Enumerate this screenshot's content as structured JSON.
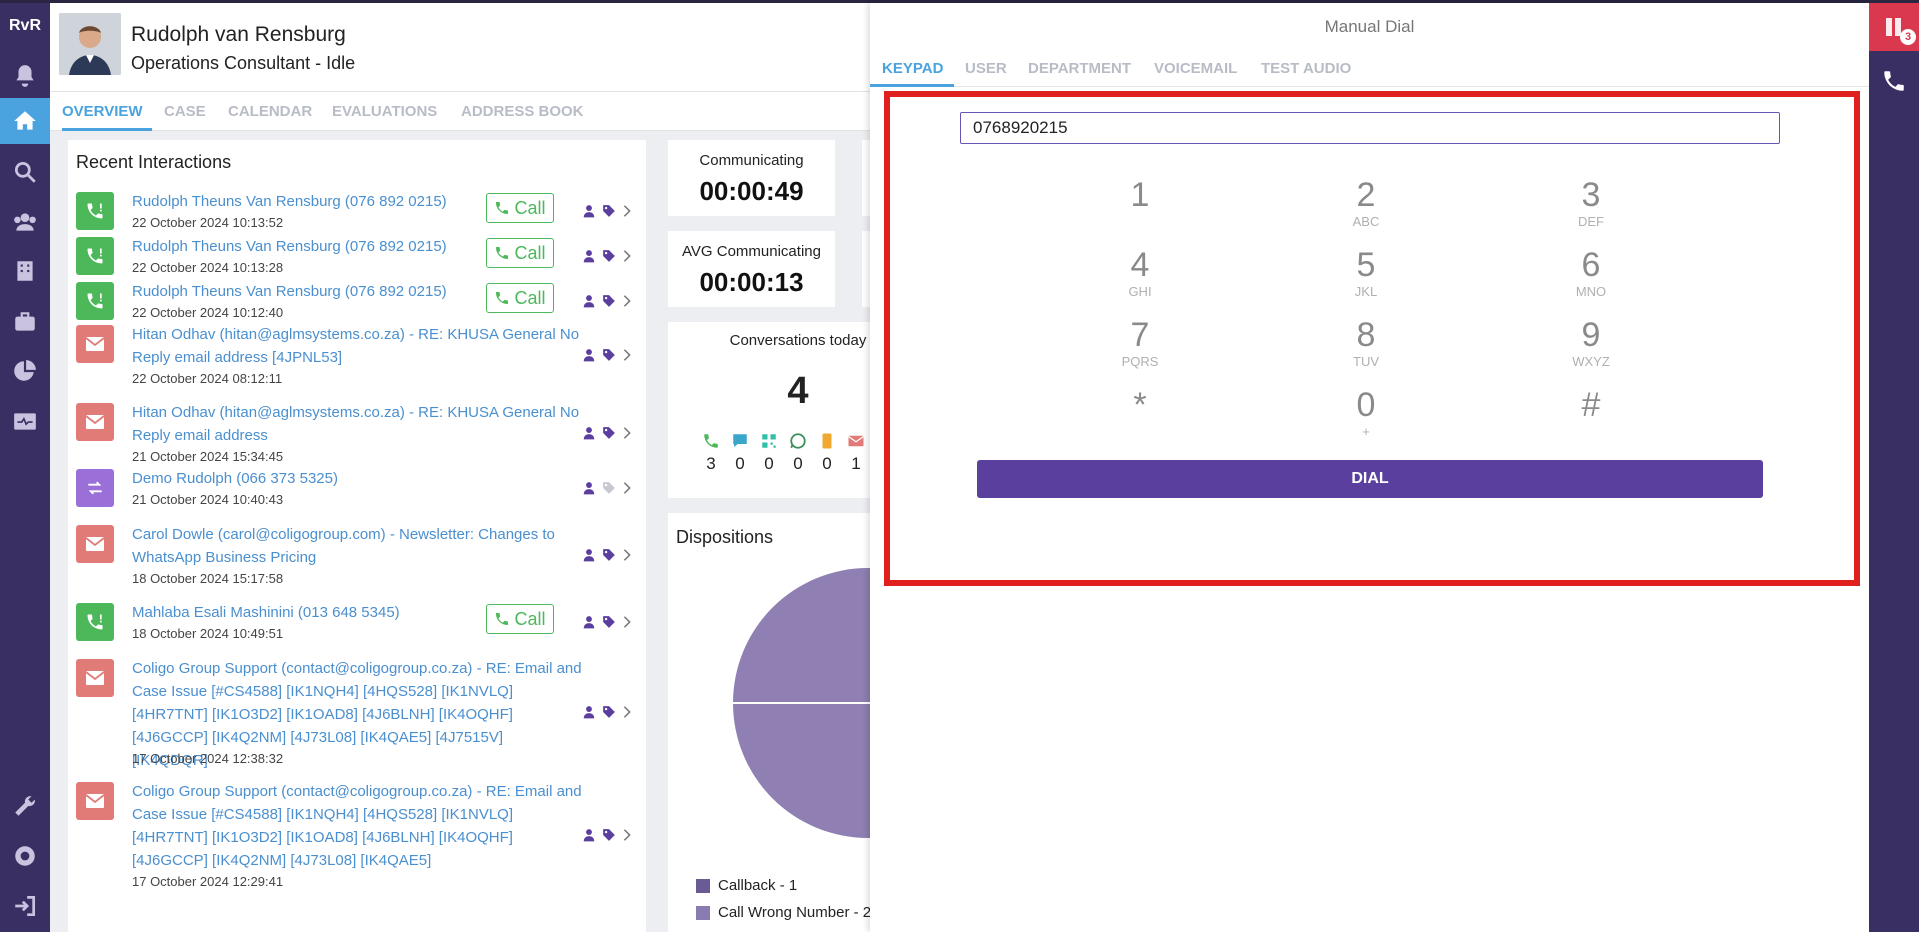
{
  "app": {
    "logo": "RvR"
  },
  "user": {
    "name": "Rudolph van Rensburg",
    "role_status": "Operations Consultant - Idle"
  },
  "tabs": [
    "OVERVIEW",
    "CASE",
    "CALENDAR",
    "EVALUATIONS",
    "ADDRESS BOOK"
  ],
  "recent": {
    "title": "Recent Interactions",
    "call_label": "Call",
    "items": [
      {
        "type": "call",
        "title": "Rudolph Theuns Van Rensburg (076 892 0215)",
        "date": "22 October 2024 10:13:52",
        "has_call": true
      },
      {
        "type": "call",
        "title": "Rudolph Theuns Van Rensburg (076 892 0215)",
        "date": "22 October 2024 10:13:28",
        "has_call": true
      },
      {
        "type": "call",
        "title": "Rudolph Theuns Van Rensburg (076 892 0215)",
        "date": "22 October 2024 10:12:40",
        "has_call": true
      },
      {
        "type": "mail",
        "title": "Hitan Odhav (hitan@aglmsystems.co.za) - RE: KHUSA General No Reply email address [4JPNL53]",
        "date": "22 October 2024 08:12:11",
        "has_call": false
      },
      {
        "type": "mail",
        "title": "Hitan Odhav (hitan@aglmsystems.co.za) - RE: KHUSA General No Reply email address",
        "date": "21 October 2024 15:34:45",
        "has_call": false
      },
      {
        "type": "xfer",
        "title": "Demo Rudolph (066 373 5325)",
        "date": "21 October 2024 10:40:43",
        "has_call": false
      },
      {
        "type": "mail",
        "title": "Carol Dowle (carol@coligogroup.com) - Newsletter: Changes to WhatsApp Business Pricing",
        "date": "18 October 2024 15:17:58",
        "has_call": false
      },
      {
        "type": "call",
        "title": "Mahlaba Esali Mashinini (013 648 5345)",
        "date": "18 October 2024 10:49:51",
        "has_call": true
      },
      {
        "type": "mail",
        "title": "Coligo Group Support (contact@coligogroup.co.za) - RE: Email and Case Issue [#CS4588] [IK1NQH4] [4HQS528] [IK1NVLQ] [4HR7TNT] [IK1O3D2] [IK1OAD8] [4J6BLNH] [IK4OQHF] [4J6GCCP] [IK4Q2NM] [4J73L08] [IK4QAE5] [4J7515V] [IK4QDQR]",
        "date": "17 October 2024 12:38:32",
        "has_call": false
      },
      {
        "type": "mail",
        "title": "Coligo Group Support (contact@coligogroup.co.za) - RE: Email and Case Issue [#CS4588] [IK1NQH4] [4HQS528] [IK1NVLQ] [4HR7TNT] [IK1O3D2] [IK1OAD8] [4J6BLNH] [IK4OQHF] [4J6GCCP] [IK4Q2NM] [4J73L08] [IK4QAE5]",
        "date": "17 October 2024 12:29:41",
        "has_call": false
      }
    ]
  },
  "stats": {
    "communicating_label": "Communicating",
    "communicating_value": "00:00:49",
    "avg_label": "AVG Communicating",
    "avg_value": "00:00:13"
  },
  "conversations": {
    "title": "Conversations today",
    "count": "4",
    "channels": [
      {
        "icon": "phone-icon",
        "color": "#4cb85a",
        "count": "3"
      },
      {
        "icon": "chat-icon",
        "color": "#3aa6c9",
        "count": "0"
      },
      {
        "icon": "qr-icon",
        "color": "#2fbfa4",
        "count": "0"
      },
      {
        "icon": "whatsapp-icon",
        "color": "#3a8f5a",
        "count": "0"
      },
      {
        "icon": "sms-icon",
        "color": "#f0a830",
        "count": "0"
      },
      {
        "icon": "email-icon",
        "color": "#e07b77",
        "count": "1"
      }
    ]
  },
  "dispositions": {
    "title": "Dispositions",
    "legend": [
      {
        "label": "Callback - 1",
        "color": "#6b5b95"
      },
      {
        "label": "Call Wrong Number - 2",
        "color": "#8a7bb0"
      }
    ]
  },
  "dial": {
    "title": "Manual Dial",
    "tabs": [
      "KEYPAD",
      "USER",
      "DEPARTMENT",
      "VOICEMAIL",
      "TEST AUDIO"
    ],
    "number": "0768920215",
    "keys": [
      {
        "d": "1",
        "l": ""
      },
      {
        "d": "2",
        "l": "ABC"
      },
      {
        "d": "3",
        "l": "DEF"
      },
      {
        "d": "4",
        "l": "GHI"
      },
      {
        "d": "5",
        "l": "JKL"
      },
      {
        "d": "6",
        "l": "MNO"
      },
      {
        "d": "7",
        "l": "PQRS"
      },
      {
        "d": "8",
        "l": "TUV"
      },
      {
        "d": "9",
        "l": "WXYZ"
      },
      {
        "d": "*",
        "l": ""
      },
      {
        "d": "0",
        "l": "+"
      },
      {
        "d": "#",
        "l": ""
      }
    ],
    "dial_label": "DIAL"
  },
  "rail": {
    "badge": "3"
  },
  "colors": {
    "nav": "#3a2f63",
    "accent": "#4aa3df",
    "dial_button": "#5b3f9e",
    "highlight": "#e01f1f"
  }
}
